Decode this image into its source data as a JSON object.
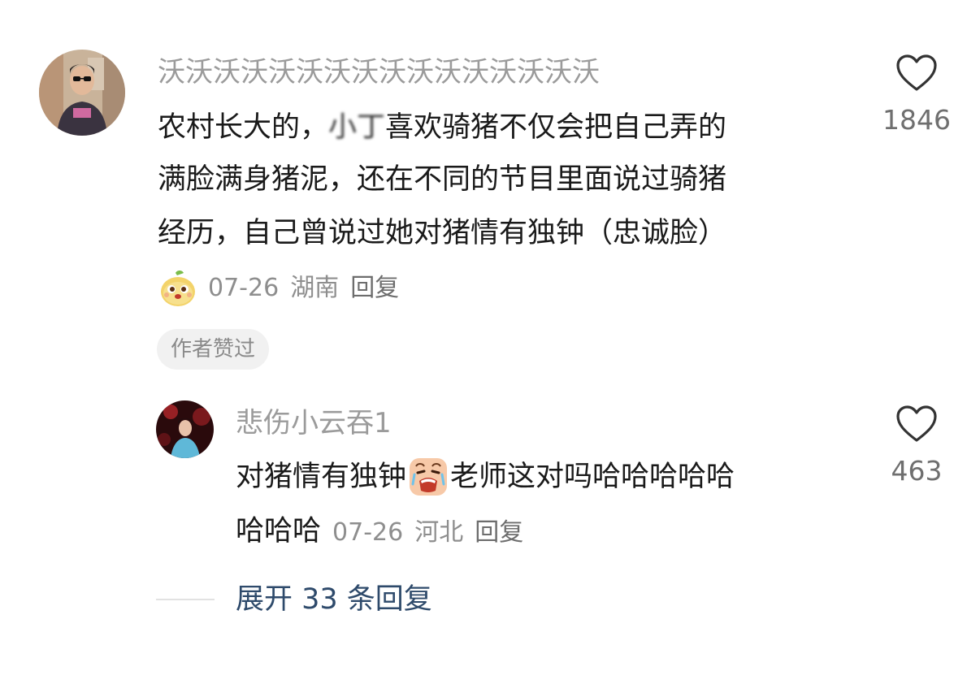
{
  "comment": {
    "username": "沃沃沃沃沃沃沃沃沃沃沃沃沃沃沃沃",
    "text_line1_a": "农村长大的，",
    "text_line1_redacted": "小丁",
    "text_line1_b": "喜欢骑猪不仅会把自己弄的",
    "text_line2": "满脸满身猪泥，还在不同的节目里面说过骑猪",
    "text_line3": "经历，自己曾说过她对猪情有独钟（忠诚脸）",
    "date": "07-26",
    "region": "湖南",
    "reply_label": "回复",
    "author_liked_badge": "作者赞过",
    "like_count": "1846",
    "sticker_icon": "pear-mascot-sticker-icon"
  },
  "reply": {
    "username": "悲伤小云吞1",
    "text_a": "对猪情有独钟",
    "text_b": "老师这对吗哈哈哈哈哈",
    "text_tail": "哈哈哈",
    "date": "07-26",
    "region": "河北",
    "reply_label": "回复",
    "like_count": "463",
    "inline_emoji": "crying-face-emoji-icon"
  },
  "expand": {
    "label": "展开 33 条回复"
  },
  "colors": {
    "username": "#9b9b9b",
    "text": "#1a1a1a",
    "meta": "#8e8e8e",
    "expand_link": "#2e4a6b",
    "badge_bg": "#f1f1f1"
  }
}
